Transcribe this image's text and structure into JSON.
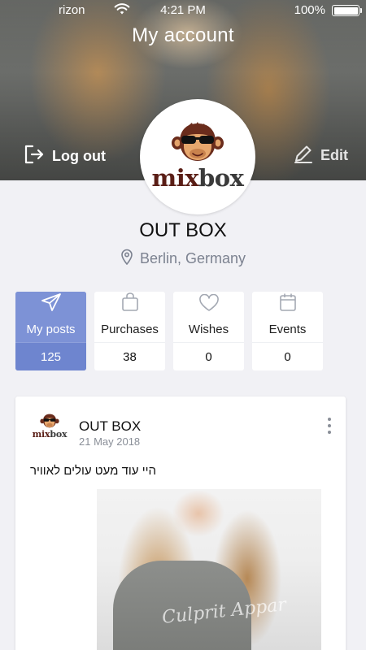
{
  "status_bar": {
    "carrier": "rizon",
    "time": "4:21 PM",
    "battery": "100%"
  },
  "header": {
    "title": "My account",
    "logout_label": "Log out",
    "edit_label": "Edit"
  },
  "brand": {
    "mix": "mix",
    "box": "box"
  },
  "profile": {
    "name": "OUT BOX",
    "location": "Berlin, Germany"
  },
  "stats": [
    {
      "label": "My posts",
      "count": "125",
      "icon": "paper-plane-icon",
      "active": true
    },
    {
      "label": "Purchases",
      "count": "38",
      "icon": "shopping-bag-icon",
      "active": false
    },
    {
      "label": "Wishes",
      "count": "0",
      "icon": "heart-icon",
      "active": false
    },
    {
      "label": "Events",
      "count": "0",
      "icon": "calendar-icon",
      "active": false
    }
  ],
  "post": {
    "author": "OUT BOX",
    "date": "21 May 2018",
    "text": "היי עוד מעט עולים לאוויר",
    "shirt_text": "Culprit Appar"
  },
  "colors": {
    "accent": "#7d92d6",
    "accent_dark": "#6e85cf",
    "background": "#f1f1f5",
    "muted_text": "#7c8290"
  }
}
